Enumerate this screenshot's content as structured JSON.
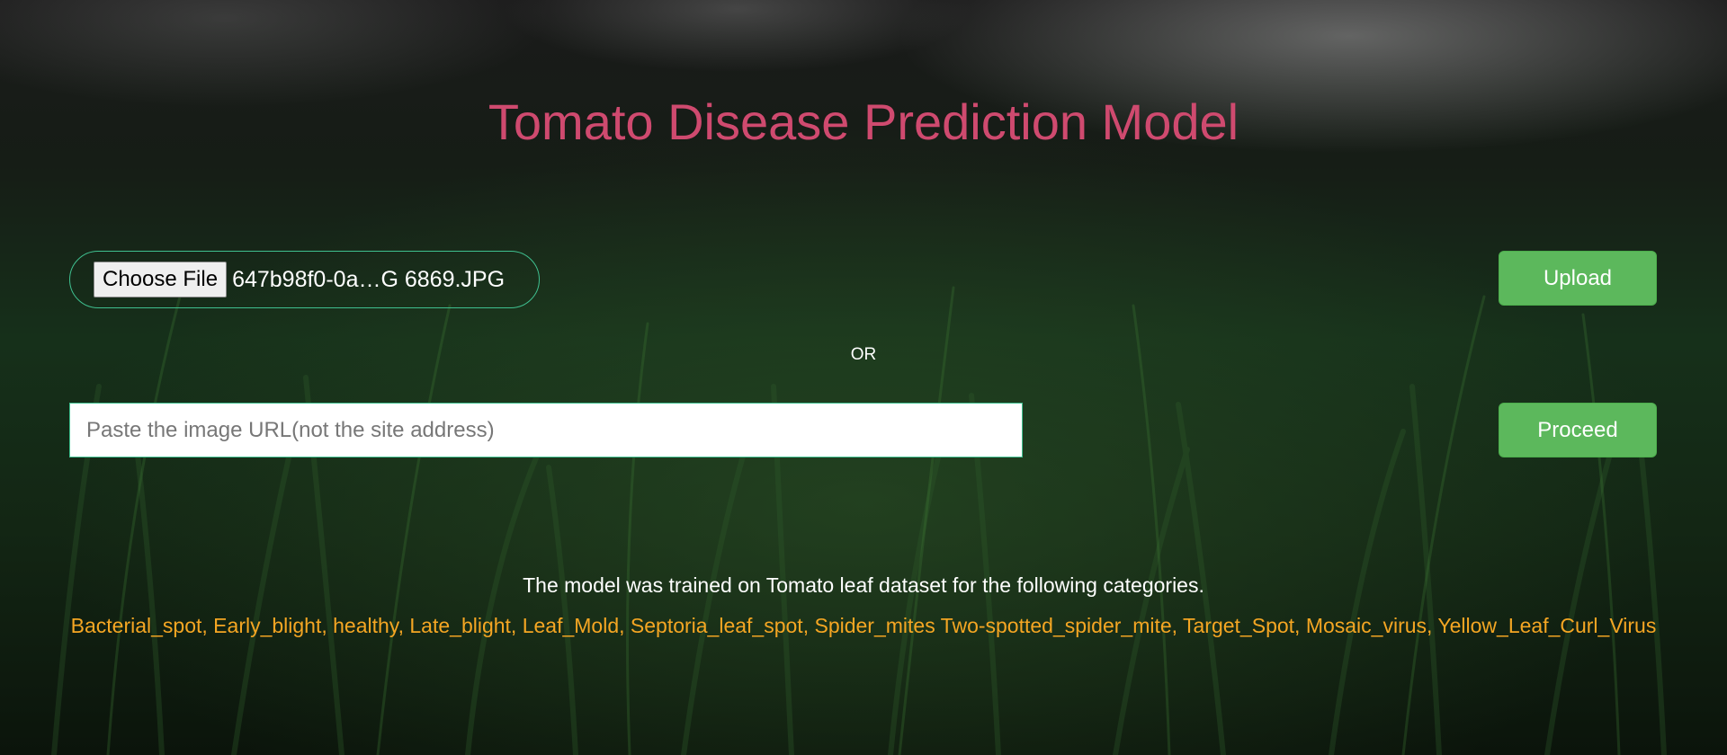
{
  "page": {
    "title": "Tomato Disease Prediction Model"
  },
  "upload": {
    "choose_file_label": "Choose File",
    "file_name": "647b98f0-0a…G 6869.JPG",
    "upload_label": "Upload"
  },
  "divider": {
    "or_label": "OR"
  },
  "url": {
    "placeholder": "Paste the image URL(not the site address)",
    "value": "",
    "proceed_label": "Proceed"
  },
  "info": {
    "description": "The model was trained on Tomato leaf dataset for the following categories.",
    "categories": "Bacterial_spot, Early_blight, healthy, Late_blight, Leaf_Mold, Septoria_leaf_spot, Spider_mites Two-spotted_spider_mite, Target_Spot, Mosaic_virus, Yellow_Leaf_Curl_Virus"
  },
  "colors": {
    "title": "#cf4a6f",
    "button": "#5cb85c",
    "categories": "#f5a623",
    "border": "#3fbf8f"
  }
}
